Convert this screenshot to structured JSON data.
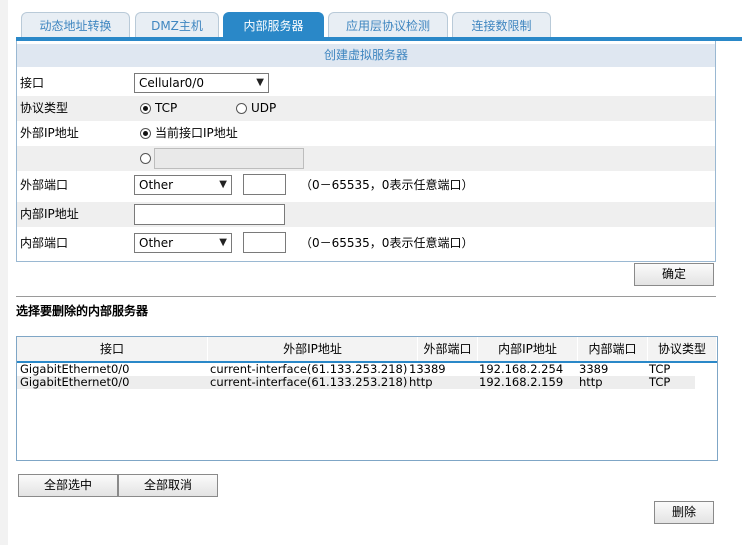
{
  "tabs": [
    {
      "label": "动态地址转换",
      "active": false
    },
    {
      "label": "DMZ主机",
      "active": false
    },
    {
      "label": "内部服务器",
      "active": true
    },
    {
      "label": "应用层协议检测",
      "active": false
    },
    {
      "label": "连接数限制",
      "active": false
    }
  ],
  "form": {
    "title": "创建虚拟服务器",
    "interface": {
      "label": "接口",
      "value": "Cellular0/0"
    },
    "protocol": {
      "label": "协议类型",
      "options": [
        "TCP",
        "UDP"
      ],
      "selected": "TCP"
    },
    "external_ip": {
      "label": "外部IP地址",
      "option_current": "当前接口IP地址",
      "custom_value": ""
    },
    "external_port": {
      "label": "外部端口",
      "select_value": "Other",
      "port_value": "",
      "hint": "（0－65535，0表示任意端口）"
    },
    "internal_ip": {
      "label": "内部IP地址",
      "value": ""
    },
    "internal_port": {
      "label": "内部端口",
      "select_value": "Other",
      "port_value": "",
      "hint": "（0－65535，0表示任意端口）"
    },
    "confirm_label": "确定"
  },
  "list": {
    "section_title": "选择要删除的内部服务器",
    "columns": [
      "接口",
      "外部IP地址",
      "外部端口",
      "内部IP地址",
      "内部端口",
      "协议类型"
    ],
    "rows": [
      [
        "GigabitEthernet0/0",
        "current-interface(61.133.253.218)",
        "13389",
        "192.168.2.254",
        "3389",
        "TCP"
      ],
      [
        "GigabitEthernet0/0",
        "current-interface(61.133.253.218)",
        "http",
        "192.168.2.159",
        "http",
        "TCP"
      ]
    ],
    "select_all_label": "全部选中",
    "deselect_all_label": "全部取消",
    "delete_label": "删除"
  },
  "colors": {
    "accent": "#2a88c8",
    "tab_text": "#3f86c0",
    "header_bg": "#dfe7f1"
  }
}
